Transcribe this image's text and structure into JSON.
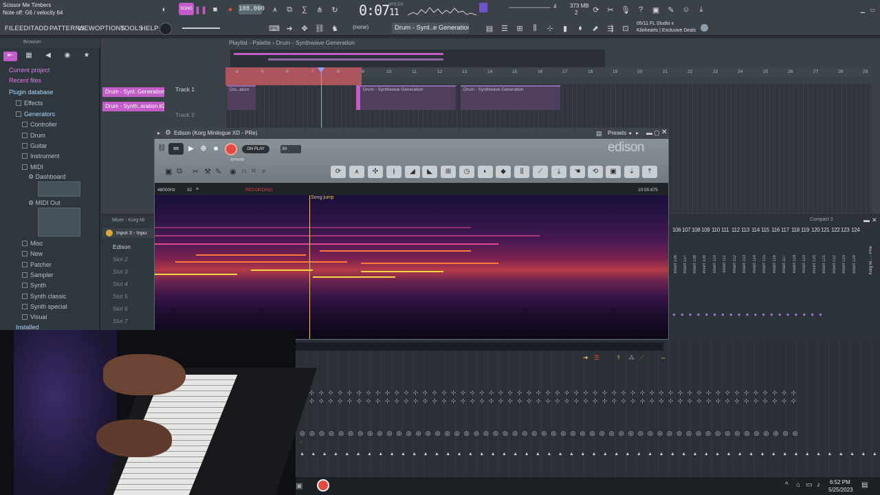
{
  "app": {
    "song_title": "Scissor Me Timbers",
    "hint": "Note off: G6 / velocity 64",
    "transport_mode": "SONG",
    "tempo": "108.000",
    "time": "0:07",
    "time_frac": "11",
    "time_unit": "M:S:CS",
    "memory_a": "4",
    "memory_b": "373 MB",
    "memory_c": "2"
  },
  "menu": [
    "FILE",
    "EDIT",
    "ADD",
    "PATTERNS",
    "VIEW",
    "OPTIONS",
    "TOOLS",
    "HELP"
  ],
  "toolbar": {
    "pattern_selector": "(none)",
    "channel_selector": "Drum - Synt..e Generation",
    "news_line1": "05/11  FL Studio x",
    "news_line2": "Kilohearts | Exclusive Deals"
  },
  "browser": {
    "header": "Browser",
    "items": [
      {
        "label": "Current project",
        "style": "hl"
      },
      {
        "label": "Recent files",
        "style": "hl"
      },
      {
        "label": "Plugin database",
        "style": "blue"
      },
      {
        "label": "Effects",
        "style": "normal"
      },
      {
        "label": "Generators",
        "style": "blue"
      },
      {
        "label": "Controller",
        "style": "normal"
      },
      {
        "label": "Drum",
        "style": "normal"
      },
      {
        "label": "Guitar",
        "style": "normal"
      },
      {
        "label": "Instrument",
        "style": "normal"
      },
      {
        "label": "MIDI",
        "style": "normal"
      },
      {
        "label": "Dashboard",
        "style": "normal"
      },
      {
        "label": "MIDI Out",
        "style": "normal"
      },
      {
        "label": "Misc",
        "style": "normal"
      },
      {
        "label": "New",
        "style": "normal"
      },
      {
        "label": "Patcher",
        "style": "normal"
      },
      {
        "label": "Sampler",
        "style": "normal"
      },
      {
        "label": "Synth",
        "style": "normal"
      },
      {
        "label": "Synth classic",
        "style": "normal"
      },
      {
        "label": "Synth special",
        "style": "normal"
      },
      {
        "label": "Visual",
        "style": "normal"
      },
      {
        "label": "Installed",
        "style": "blue"
      }
    ]
  },
  "playlist": {
    "title": "Playlist - Palette",
    "breadcrumb": "Drum - Synthwave Generation",
    "ruler": [
      "4",
      "5",
      "6",
      "7",
      "8",
      "9",
      "10",
      "11",
      "12",
      "13",
      "14",
      "15",
      "16",
      "17",
      "18",
      "19",
      "20",
      "21",
      "22",
      "23",
      "24",
      "25",
      "26",
      "27",
      "28",
      "29"
    ],
    "tracks": [
      "Track 1",
      "Track 2"
    ],
    "palette": [
      "Drum - Synt..Generation",
      "Drum - Synth..eration #2"
    ],
    "clips": [
      "Dru..ation",
      "Drum - Synthwave Generation",
      "Drum - Synthwave Generation"
    ]
  },
  "edison": {
    "title": "Edison (Korg Minilogue XD - PRe)",
    "presets": "Presets",
    "logo": "edison",
    "on_play": "ON PLAY",
    "for_value": "30",
    "append": "APPEND",
    "sample_rate": "48000Hz",
    "bits": "32",
    "status": "RECORDING",
    "length": "10:55:875",
    "marker": "Song jump"
  },
  "mixer": {
    "title": "Mixer - Korg Mi",
    "input": "Input 3 - Inpu",
    "slots": [
      "Edison",
      "Slot 2",
      "Slot 3",
      "Slot 4",
      "Slot 5",
      "Slot 6",
      "Slot 7"
    ],
    "compact_label": "Compact 2",
    "insert_numbers": [
      "106",
      "107",
      "108",
      "109",
      "110",
      "111",
      "112",
      "113",
      "114",
      "115",
      "116",
      "117",
      "118",
      "119",
      "120",
      "121",
      "122",
      "123",
      "124"
    ],
    "insert_labels": [
      "Insert 106",
      "Insert 107",
      "Insert 108",
      "Insert 109",
      "Insert 110",
      "Insert 111",
      "Insert 112",
      "Insert 113",
      "Insert 114",
      "Insert 115",
      "Insert 116",
      "Insert 117",
      "Insert 118",
      "Insert 119",
      "Insert 120",
      "Insert 121",
      "Insert 122",
      "Insert 123",
      "Insert 124"
    ],
    "side_label": "Korg M... - PRe"
  },
  "taskbar": {
    "time": "6:52 PM",
    "date": "5/25/2023"
  },
  "colors": {
    "accent": "#c25dc7",
    "record": "#e5483f",
    "loop": "#c05862",
    "spectrum_hot": "#ffd54a"
  }
}
